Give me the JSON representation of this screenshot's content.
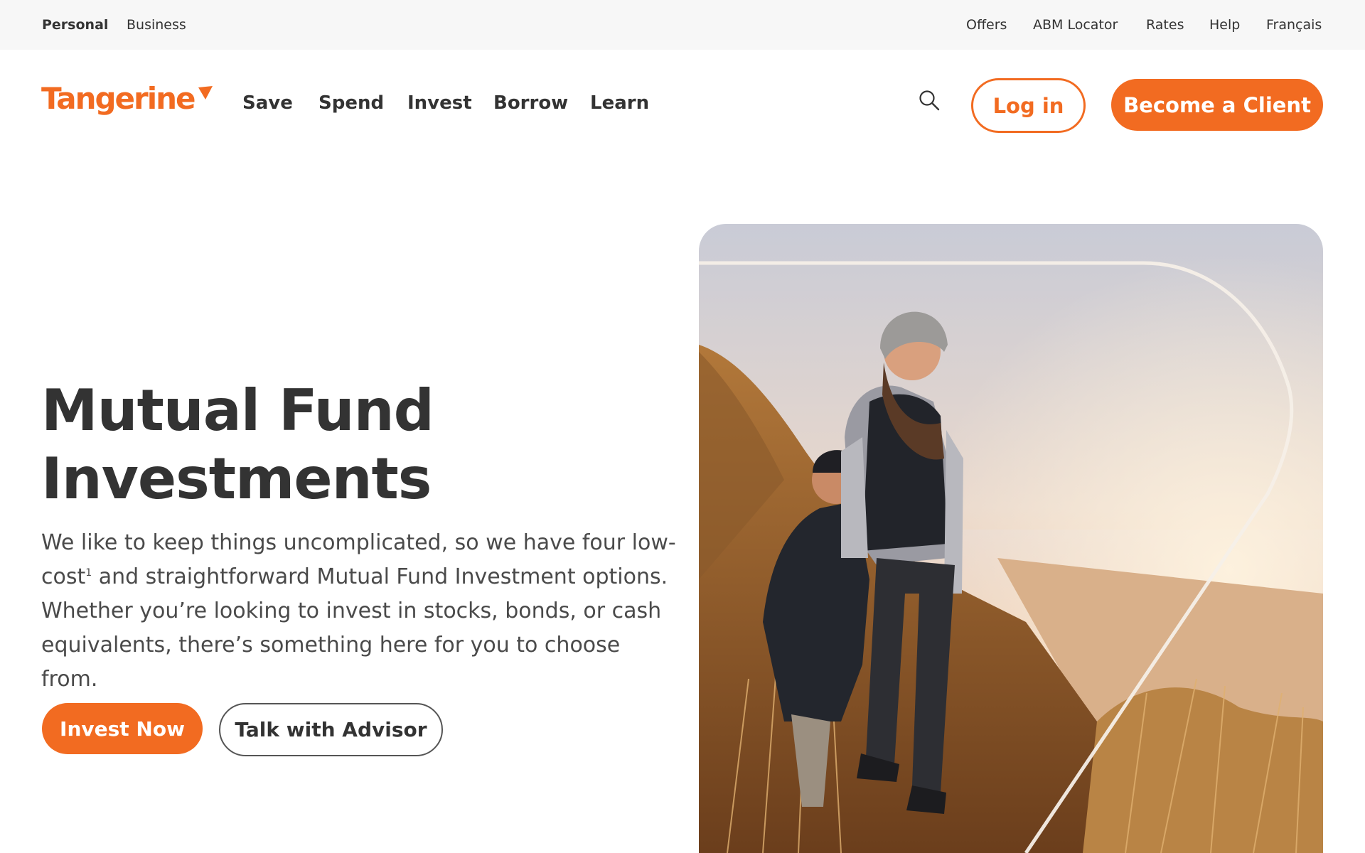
{
  "utility_nav": {
    "left": [
      {
        "label": "Personal",
        "active": true
      },
      {
        "label": "Business",
        "active": false
      }
    ],
    "right": [
      {
        "label": "Offers"
      },
      {
        "label": "ABM Locator"
      },
      {
        "label": "Rates"
      },
      {
        "label": "Help"
      },
      {
        "label": "Français"
      }
    ]
  },
  "header": {
    "logo_text": "Tangerine",
    "nav": [
      {
        "label": "Save"
      },
      {
        "label": "Spend"
      },
      {
        "label": "Invest"
      },
      {
        "label": "Borrow"
      },
      {
        "label": "Learn"
      }
    ],
    "search_icon": "search-icon",
    "login_label": "Log in",
    "become_client_label": "Become a Client"
  },
  "hero": {
    "title_line1": "Mutual Fund",
    "title_line2": "Investments",
    "text_part1": "We like to keep things uncomplicated, so we have four low-cost",
    "text_sup": "1",
    "text_part2": " and straightforward Mutual Fund Investment options. Whether you’re looking to invest in stocks, bonds, or cash equivalents, there’s something here for you to choose from.",
    "invest_now_label": "Invest Now",
    "talk_advisor_label": "Talk with Advisor"
  },
  "colors": {
    "brand_orange": "#f26b21",
    "text_dark": "#333333",
    "utility_bg": "#f7f7f7"
  }
}
